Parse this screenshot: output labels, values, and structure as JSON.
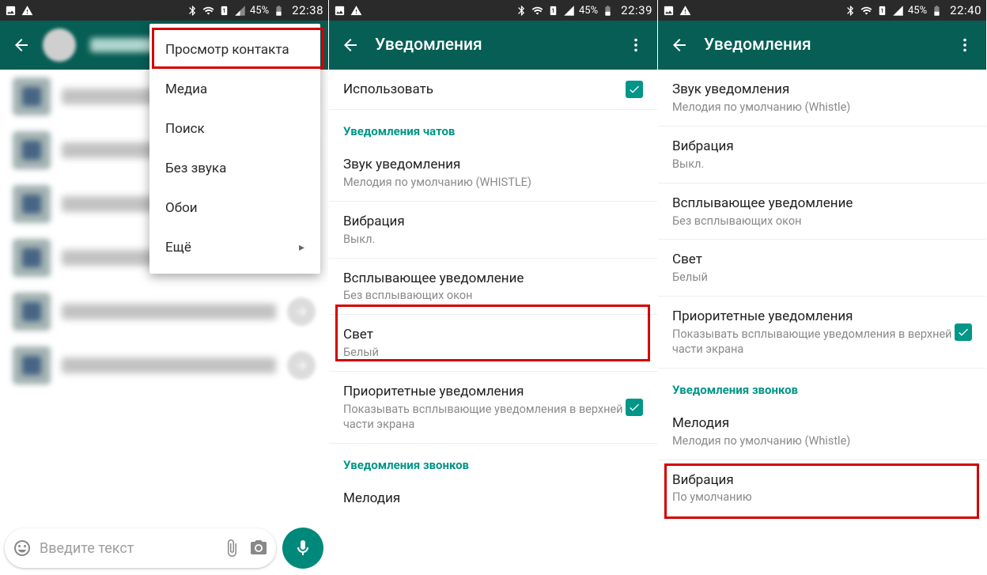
{
  "screens": [
    {
      "statusbar": {
        "battery": "45%",
        "time": "22:38"
      },
      "appbar": {
        "type": "chat"
      },
      "menu": {
        "items": [
          "Просмотр контакта",
          "Медиа",
          "Поиск",
          "Без звука",
          "Обои",
          "Ещё"
        ]
      },
      "input": {
        "placeholder": "Введите текст"
      }
    },
    {
      "statusbar": {
        "battery": "45%",
        "time": "22:39"
      },
      "appbar": {
        "title": "Уведомления"
      },
      "settings": {
        "use_custom": {
          "title": "Использовать",
          "checked": true
        },
        "chat_section": "Уведомления чатов",
        "sound": {
          "title": "Звук уведомления",
          "sub": "Мелодия по умолчанию (WHISTLE)"
        },
        "vibrate": {
          "title": "Вибрация",
          "sub": "Выкл."
        },
        "popup": {
          "title": "Всплывающее уведомление",
          "sub": "Без всплывающих окон"
        },
        "light": {
          "title": "Свет",
          "sub": "Белый"
        },
        "priority": {
          "title": "Приоритетные уведомления",
          "sub": "Показывать всплывающие уведомления в верхней части экрана",
          "checked": true
        },
        "call_section": "Уведомления звонков",
        "ringtone": {
          "title": "Мелодия"
        }
      }
    },
    {
      "statusbar": {
        "battery": "45%",
        "time": "22:40"
      },
      "appbar": {
        "title": "Уведомления"
      },
      "settings": {
        "sound": {
          "title": "Звук уведомления",
          "sub": "Мелодия по умолчанию (Whistle)"
        },
        "vibrate": {
          "title": "Вибрация",
          "sub": "Выкл."
        },
        "popup": {
          "title": "Всплывающее уведомление",
          "sub": "Без всплывающих окон"
        },
        "light": {
          "title": "Свет",
          "sub": "Белый"
        },
        "priority": {
          "title": "Приоритетные уведомления",
          "sub": "Показывать всплывающие уведомления в верхней части экрана",
          "checked": true
        },
        "call_section": "Уведомления звонков",
        "ringtone": {
          "title": "Мелодия",
          "sub": "Мелодия по умолчанию (Whistle)"
        },
        "call_vibrate": {
          "title": "Вибрация",
          "sub": "По умолчанию"
        }
      }
    }
  ]
}
